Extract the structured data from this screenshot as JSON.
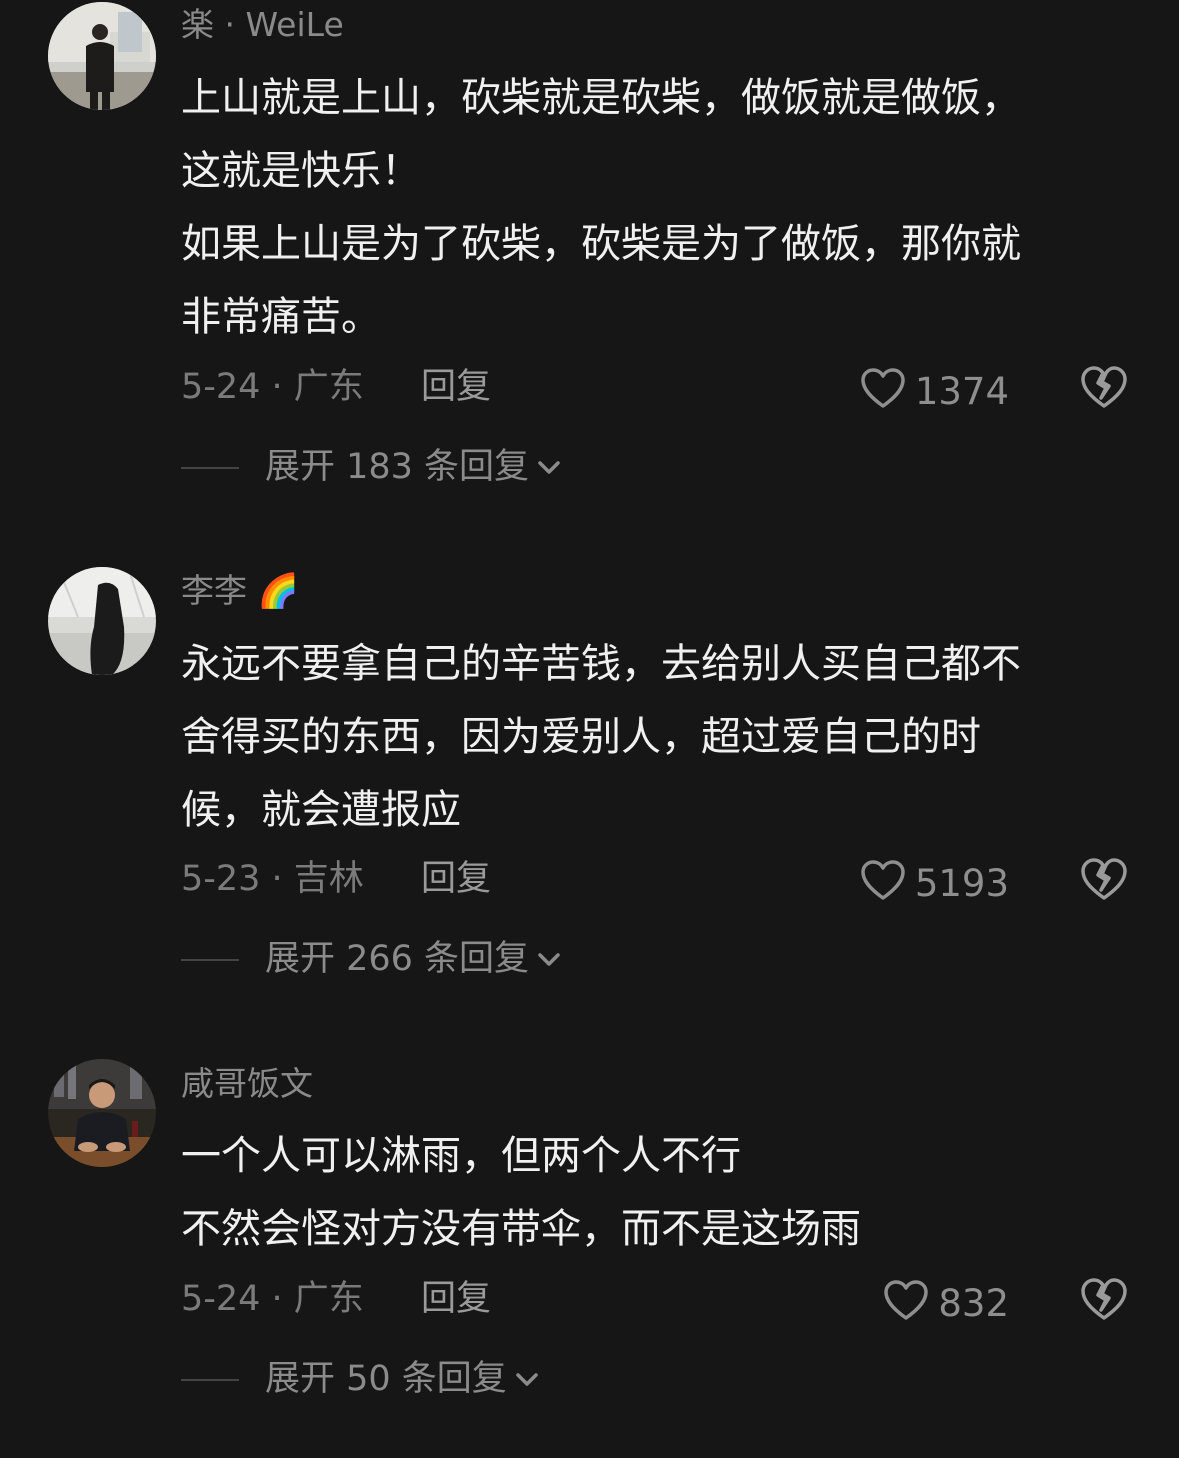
{
  "comments": [
    {
      "username": "楽 · WeiLe",
      "username_emoji": "",
      "lines": [
        "上山就是上山，砍柴就是砍柴，做饭就是做饭，",
        "这就是快乐！",
        "如果上山是为了砍柴，砍柴是为了做饭，那你就",
        "非常痛苦。"
      ],
      "date_location": "5-24 · 广东",
      "reply_label": "回复",
      "likes": "1374",
      "expand_label": "展开 183 条回复"
    },
    {
      "username": "李李",
      "username_emoji": "🌈",
      "lines": [
        "永远不要拿自己的辛苦钱，去给别人买自己都不",
        "舍得买的东西，因为爱别人，超过爱自己的时",
        "候，就会遭报应"
      ],
      "date_location": "5-23 · 吉林",
      "reply_label": "回复",
      "likes": "5193",
      "expand_label": "展开 266 条回复"
    },
    {
      "username": "咸哥饭文",
      "username_emoji": "",
      "lines": [
        "一个人可以淋雨，但两个人不行",
        "不然会怪对方没有带伞，而不是这场雨"
      ],
      "date_location": "5-24 · 广东",
      "reply_label": "回复",
      "likes": "832",
      "expand_label": "展开 50 条回复"
    }
  ]
}
